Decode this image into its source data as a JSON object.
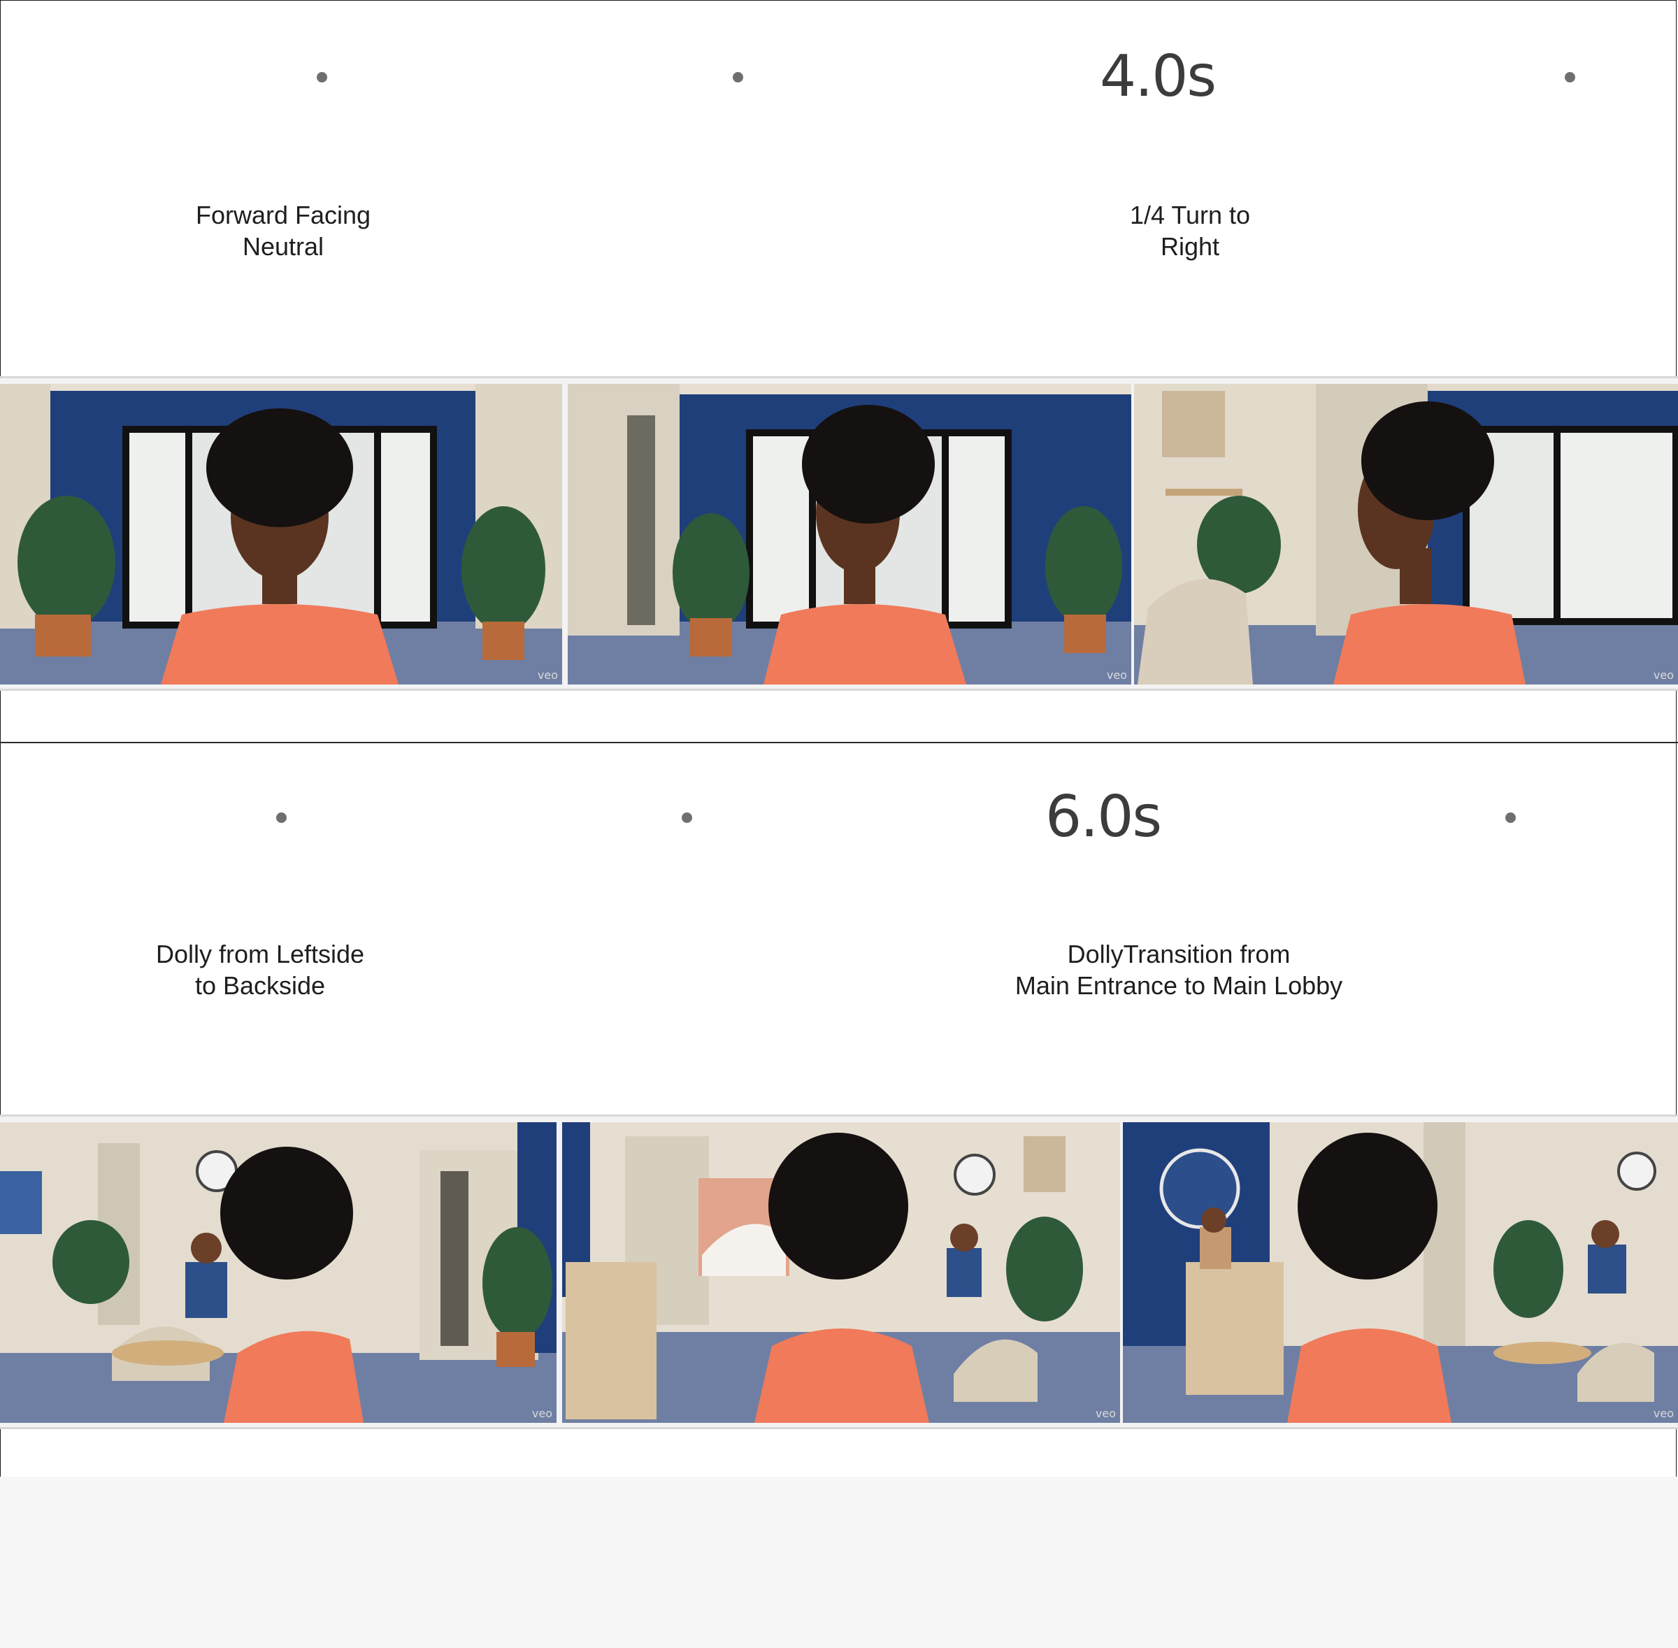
{
  "colors": {
    "wall_blue": "#1f3f7a",
    "wall_cream": "#e9e2d4",
    "carpet": "#6f7fa4",
    "shirt": "#f07a5a",
    "skin": "#5a3420",
    "hair": "#151110",
    "plant": "#2f5a3a",
    "pot": "#b86a3a"
  },
  "timeline": [
    {
      "time_label": "4.0s",
      "shots": [
        {
          "label": "Forward Facing\nNeutral"
        },
        {
          "label": "1/4 Turn to\nRight"
        }
      ],
      "frames": [
        {
          "scene": "front-entrance",
          "view": "front"
        },
        {
          "scene": "front-entrance-wide",
          "view": "three-quarter"
        },
        {
          "scene": "lobby-side",
          "view": "profile"
        }
      ],
      "watermark": "veo"
    },
    {
      "time_label": "6.0s",
      "shots": [
        {
          "label": "Dolly from Leftside\nto Backside"
        },
        {
          "label": "DollyTransition from\nMain Entrance to Main Lobby"
        }
      ],
      "frames": [
        {
          "scene": "lobby-seating",
          "view": "back-left"
        },
        {
          "scene": "lobby-hallway",
          "view": "back"
        },
        {
          "scene": "lobby-reception",
          "view": "back"
        }
      ],
      "watermark": "veo"
    }
  ]
}
